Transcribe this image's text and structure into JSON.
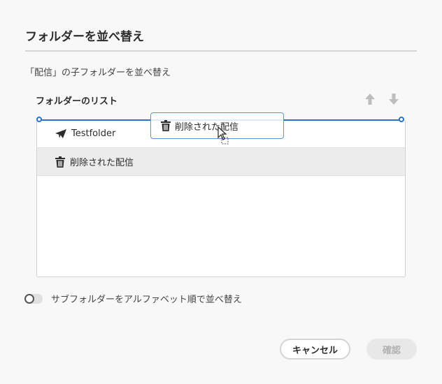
{
  "dialog": {
    "title": "フォルダーを並べ替え",
    "subtitle": "「配信」の子フォルダーを並べ替え",
    "list_label": "フォルダーのリスト",
    "move_up_icon": "arrow-up-icon",
    "move_down_icon": "arrow-down-icon",
    "accent_color": "#2e71c9"
  },
  "folders": [
    {
      "label": "Testfolder",
      "icon": "paper-plane-icon"
    },
    {
      "label": "削除された配信",
      "icon": "trash-icon"
    }
  ],
  "drag": {
    "label": "削除された配信",
    "icon": "trash-icon"
  },
  "toggle": {
    "label": "サブフォルダーをアルファベット順で並べ替え",
    "on": false
  },
  "buttons": {
    "cancel": "キャンセル",
    "confirm": "確認"
  }
}
